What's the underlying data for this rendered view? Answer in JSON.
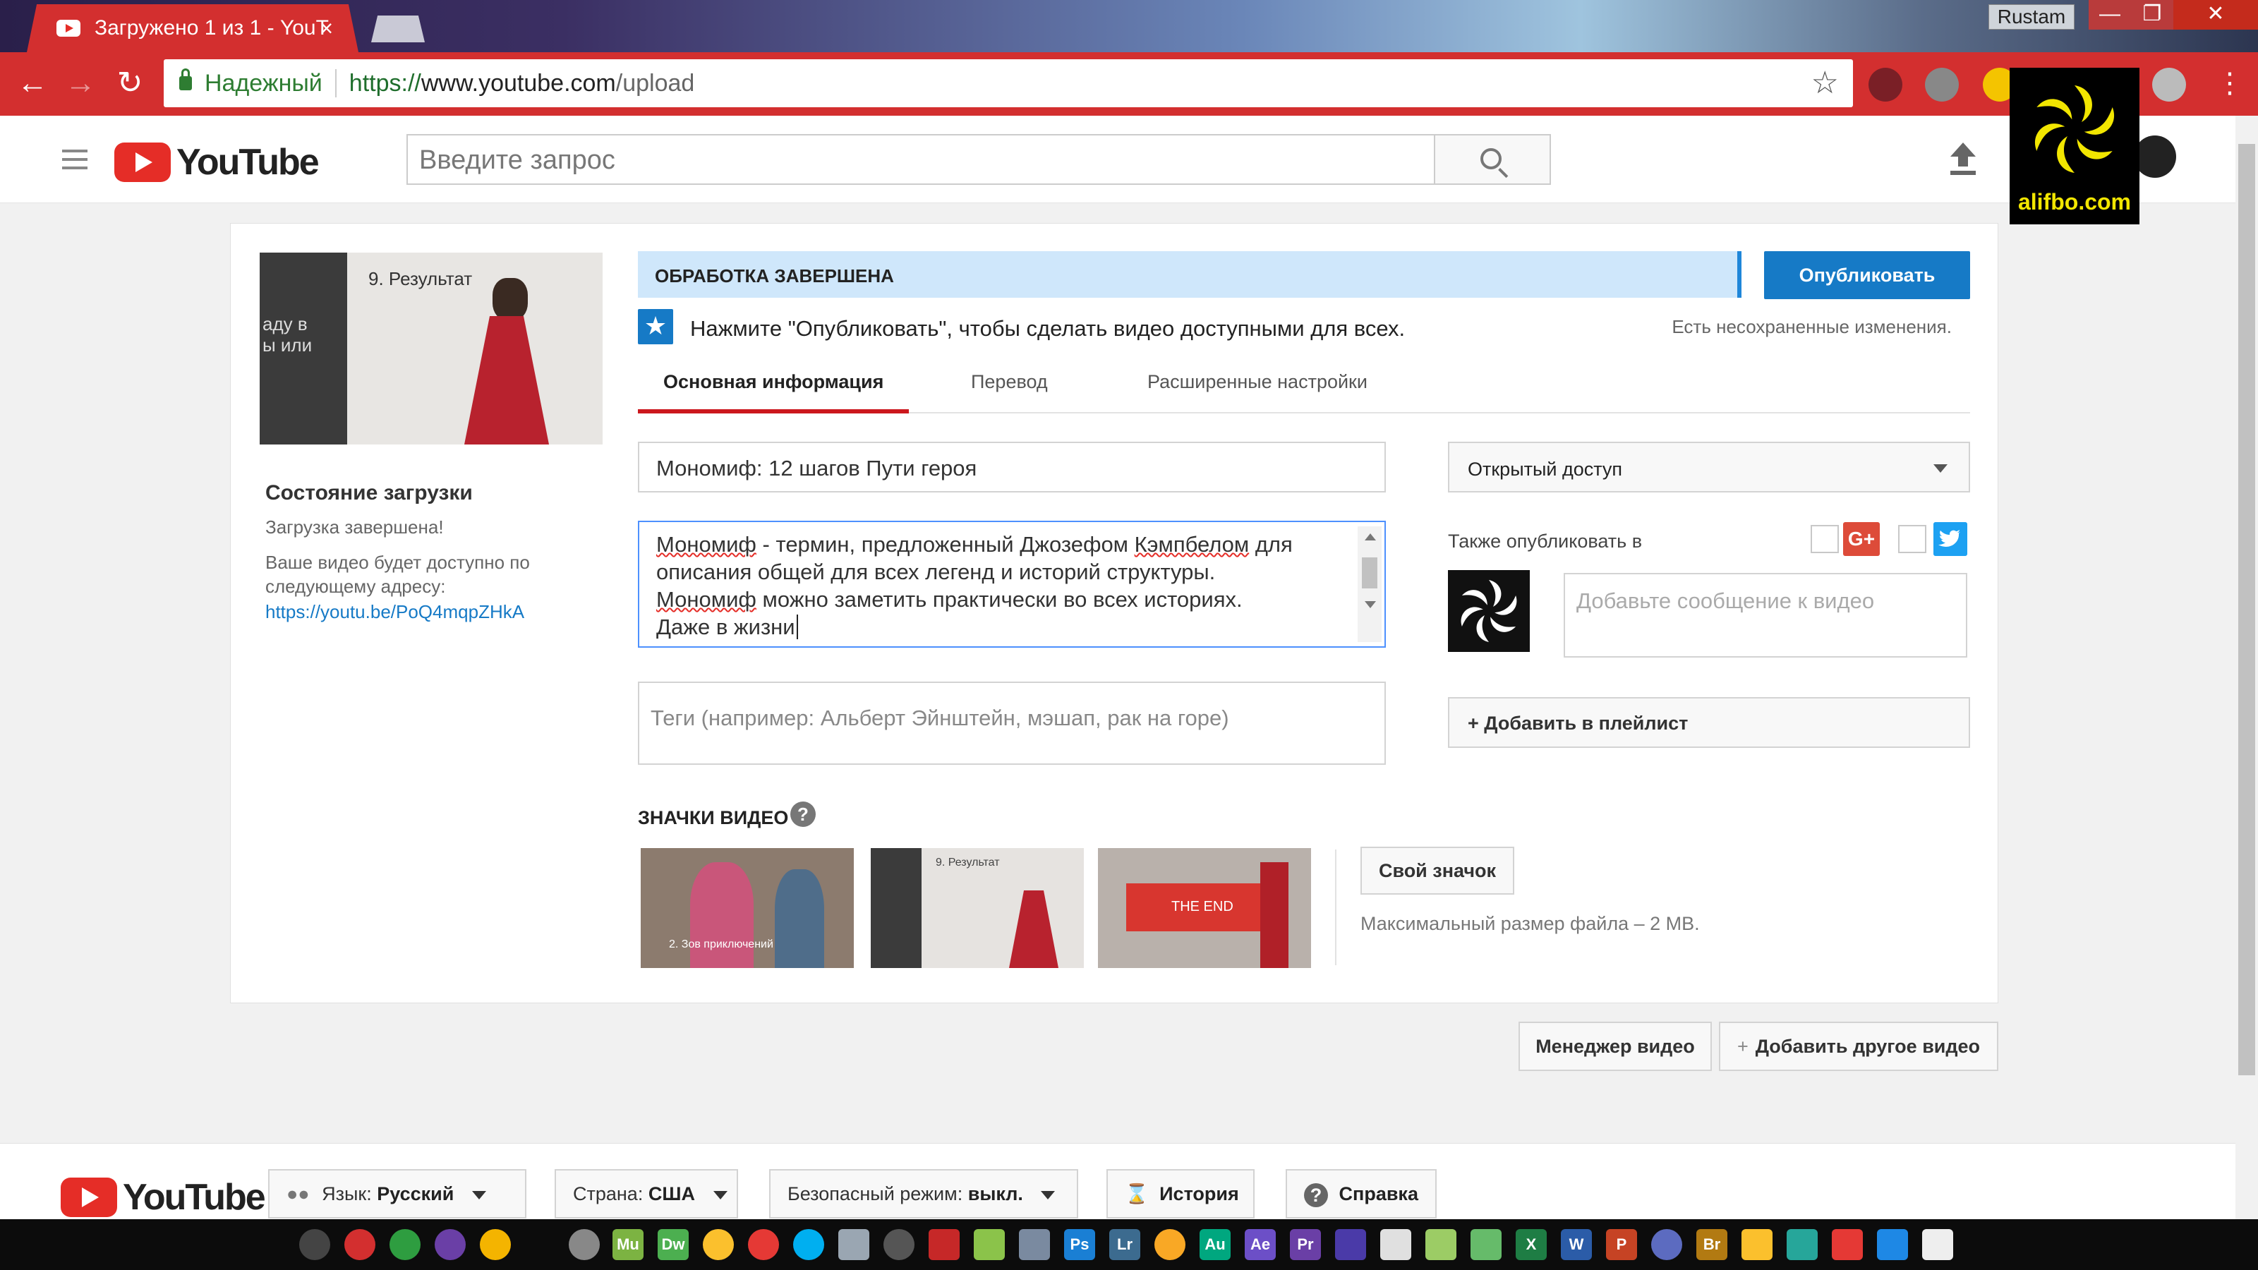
{
  "browser": {
    "tab_title": "Загружено 1 из 1 - YouT",
    "tab_close": "×",
    "user": "Rustam",
    "secure_label": "Надежный",
    "url_scheme": "https://",
    "url_host": "www.youtube.com",
    "url_path": "/upload"
  },
  "watermark": {
    "text": "alifbo.com"
  },
  "header": {
    "logo": "YouTube",
    "search_placeholder": "Введите запрос"
  },
  "upload": {
    "thumbnail_caption": "9. Результат",
    "thumbnail_side_text": "аду в\nы или",
    "status_title": "Состояние загрузки",
    "status_sub": "Загрузка завершена!",
    "status_note": "Ваше видео будет доступно по следующему адресу:",
    "status_link": "https://youtu.be/PoQ4mqpZHkA",
    "processing": "ОБРАБОТКА ЗАВЕРШЕНА",
    "publish_button": "Опубликовать",
    "hint": "Нажмите \"Опубликовать\", чтобы сделать видео доступными для всех.",
    "unsaved": "Есть несохраненные изменения.",
    "tabs": [
      "Основная информация",
      "Перевод",
      "Расширенные настройки"
    ],
    "title_value": "Мономиф: 12 шагов Пути героя",
    "description": {
      "w1": "Мономиф",
      "t1": " - термин, предложенный Джозефом ",
      "w2": "Кэмпбелом",
      "t2": " для описания общей для всех легенд и историй структуры.",
      "w3": "Мономиф",
      "t3": " можно заметить практически во всех историях.",
      "t4": "Даже в жизни"
    },
    "tags_placeholder": "Теги (например: Альберт Эйнштейн, мэшап, рак на горе)",
    "privacy": "Открытый доступ",
    "also_publish": "Также опубликовать в",
    "gplus": "G+",
    "message_placeholder": "Добавьте сообщение к видео",
    "playlist_button": "+ Добавить в плейлист",
    "thumbs_title": "ЗНАЧКИ ВИДЕО",
    "thumbs_help": "?",
    "thumb_captions": [
      "2. Зов приключений",
      "9. Результат",
      "THE END"
    ],
    "own_thumb": "Свой значок",
    "max_size": "Максимальный размер файла – 2 MB.",
    "video_manager": "Менеджер видео",
    "add_video": "Добавить другое видео"
  },
  "footer": {
    "logo": "YouTube",
    "lang_label": "Язык:",
    "lang_value": "Русский",
    "country_label": "Страна:",
    "country_value": "США",
    "safe_label": "Безопасный режим:",
    "safe_value": "выкл.",
    "history": "История",
    "help": "Справка"
  },
  "taskbar": {
    "apps": [
      {
        "label": "Mu",
        "color": "#7cb342"
      },
      {
        "label": "Dw",
        "color": "#4caf50"
      },
      {
        "label": "Ps",
        "color": "#1a7fd4"
      },
      {
        "label": "Lr",
        "color": "#3c6b8f"
      },
      {
        "label": "Au",
        "color": "#00a77f"
      },
      {
        "label": "Ae",
        "color": "#6c4fc7"
      },
      {
        "label": "Pr",
        "color": "#6a3fa6"
      },
      {
        "label": "X",
        "color": "#1e7d44"
      },
      {
        "label": "W",
        "color": "#2b5ca8"
      },
      {
        "label": "P",
        "color": "#c64324"
      },
      {
        "label": "Br",
        "color": "#b27a12"
      }
    ]
  }
}
